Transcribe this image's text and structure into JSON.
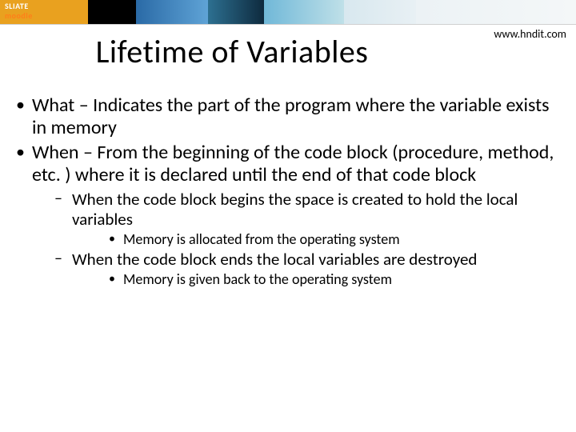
{
  "brand": {
    "line1": "SLIATE",
    "line2": "moodle"
  },
  "url": "www.hndit.com",
  "title": "Lifetime of Variables",
  "bullets": [
    {
      "text": "What – Indicates the part of the program where the variable exists in memory"
    },
    {
      "text": " When – From the beginning of the code block (procedure, method, etc. ) where it is declared until the end of that code block",
      "children": [
        {
          "text": "When the code block begins the space is created to hold the local variables",
          "children": [
            {
              "text": "Memory is allocated from the operating system"
            }
          ]
        },
        {
          "text": "When the code block ends the local variables are destroyed",
          "children": [
            {
              "text": "Memory is given back to the operating system"
            }
          ]
        }
      ]
    }
  ]
}
